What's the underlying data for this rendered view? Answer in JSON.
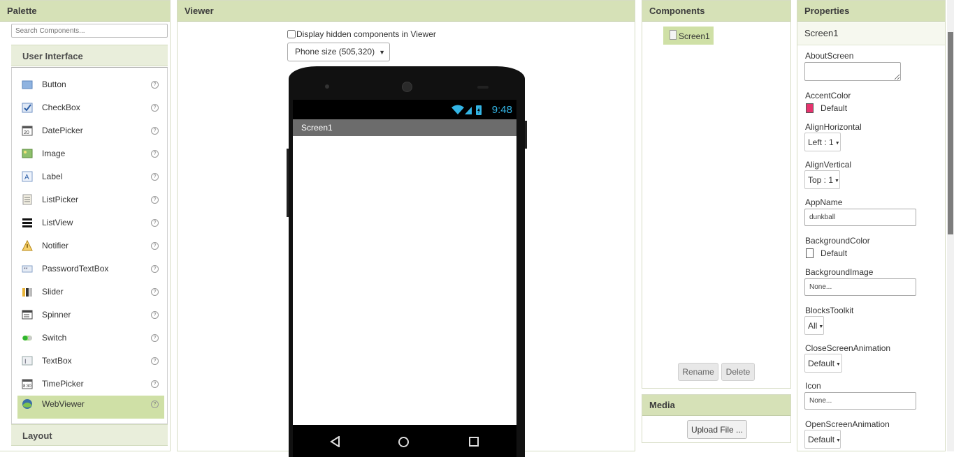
{
  "palette": {
    "title": "Palette",
    "search_placeholder": "Search Components...",
    "category_user_interface": "User Interface",
    "category_layout": "Layout",
    "help_glyph": "?",
    "items": [
      {
        "label": "Button",
        "icon": "button-icon"
      },
      {
        "label": "CheckBox",
        "icon": "checkbox-icon"
      },
      {
        "label": "DatePicker",
        "icon": "datepicker-icon"
      },
      {
        "label": "Image",
        "icon": "image-icon"
      },
      {
        "label": "Label",
        "icon": "label-icon"
      },
      {
        "label": "ListPicker",
        "icon": "listpicker-icon"
      },
      {
        "label": "ListView",
        "icon": "listview-icon"
      },
      {
        "label": "Notifier",
        "icon": "notifier-icon"
      },
      {
        "label": "PasswordTextBox",
        "icon": "password-icon"
      },
      {
        "label": "Slider",
        "icon": "slider-icon"
      },
      {
        "label": "Spinner",
        "icon": "spinner-icon"
      },
      {
        "label": "Switch",
        "icon": "switch-icon"
      },
      {
        "label": "TextBox",
        "icon": "textbox-icon"
      },
      {
        "label": "TimePicker",
        "icon": "timepicker-icon"
      },
      {
        "label": "WebViewer",
        "icon": "webviewer-icon",
        "selected": true
      }
    ]
  },
  "viewer": {
    "title": "Viewer",
    "hidden_checkbox_label": "Display hidden components in Viewer",
    "size_select_value": "Phone size (505,320)",
    "phone": {
      "status_time": "9:48",
      "screen_title": "Screen1"
    }
  },
  "components": {
    "title": "Components",
    "tree_root": "Screen1",
    "rename_label": "Rename",
    "delete_label": "Delete"
  },
  "media": {
    "title": "Media",
    "upload_label": "Upload File ..."
  },
  "properties": {
    "title": "Properties",
    "selected_component": "Screen1",
    "about_screen_label": "AboutScreen",
    "accent_color_label": "AccentColor",
    "accent_color_value": "Default",
    "accent_color_hex": "#e6336e",
    "align_horizontal_label": "AlignHorizontal",
    "align_horizontal_value": "Left : 1",
    "align_vertical_label": "AlignVertical",
    "align_vertical_value": "Top : 1",
    "app_name_label": "AppName",
    "app_name_value": "dunkball",
    "background_color_label": "BackgroundColor",
    "background_color_value": "Default",
    "background_color_hex": "#ffffff",
    "background_image_label": "BackgroundImage",
    "background_image_value": "None...",
    "blocks_toolkit_label": "BlocksToolkit",
    "blocks_toolkit_value": "All",
    "close_anim_label": "CloseScreenAnimation",
    "close_anim_value": "Default",
    "icon_label": "Icon",
    "icon_value": "None...",
    "open_anim_label": "OpenScreenAnimation",
    "open_anim_value": "Default"
  },
  "colors": {
    "header_green": "#d6e1b7",
    "selected_green": "#cfe0a6",
    "status_blue": "#33b5e5"
  }
}
